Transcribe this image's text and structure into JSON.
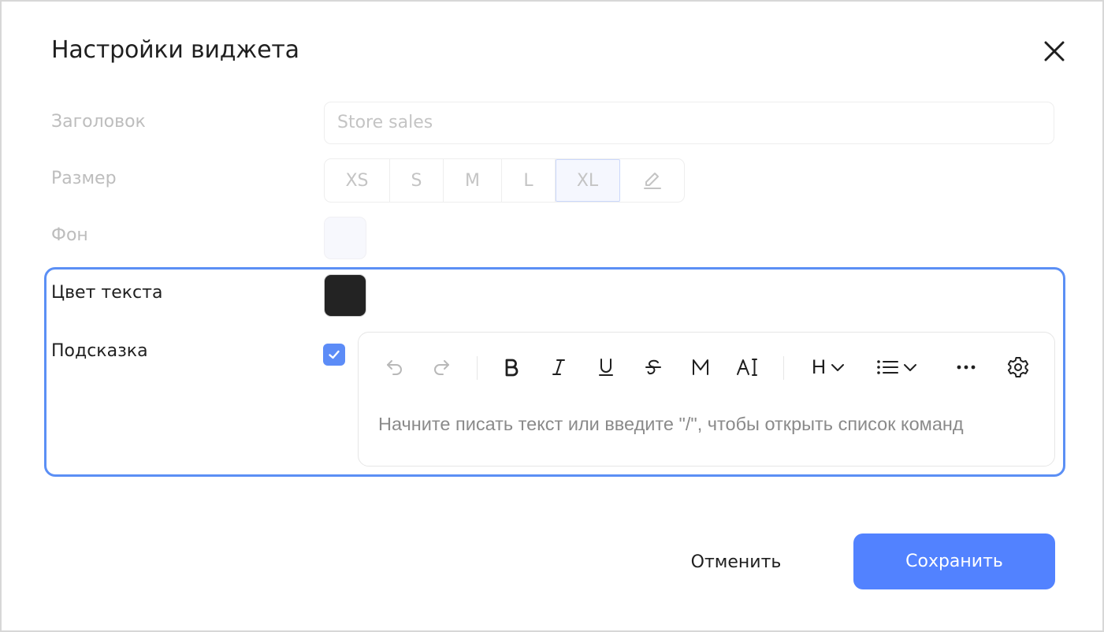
{
  "dialog": {
    "title": "Настройки виджета",
    "close_icon": "close-icon"
  },
  "form": {
    "title_field": {
      "label": "Заголовок",
      "value": "Store sales"
    },
    "size": {
      "label": "Размер",
      "options": [
        "XS",
        "S",
        "M",
        "L",
        "XL"
      ],
      "selected": "XL",
      "custom_icon": "pencil-icon"
    },
    "background": {
      "label": "Фон",
      "color": "#f7f8fd"
    },
    "text_color": {
      "label": "Цвет текста",
      "color": "#232323"
    },
    "hint": {
      "label": "Подсказка",
      "checked": true,
      "editor": {
        "toolbar": [
          "undo-icon",
          "redo-icon",
          "bold-icon",
          "italic-icon",
          "underline-icon",
          "strikethrough-icon",
          "monospace-icon",
          "text-color-icon",
          "heading-icon",
          "list-icon",
          "more-icon",
          "settings-icon"
        ],
        "heading_label": "H",
        "placeholder": "Начните писать текст или введите \"/\", чтобы открыть список команд"
      }
    }
  },
  "footer": {
    "cancel_label": "Отменить",
    "save_label": "Сохранить"
  },
  "colors": {
    "accent": "#5282ff",
    "focus_border": "#5b8ff5",
    "checkbox": "#5c8cf7"
  }
}
